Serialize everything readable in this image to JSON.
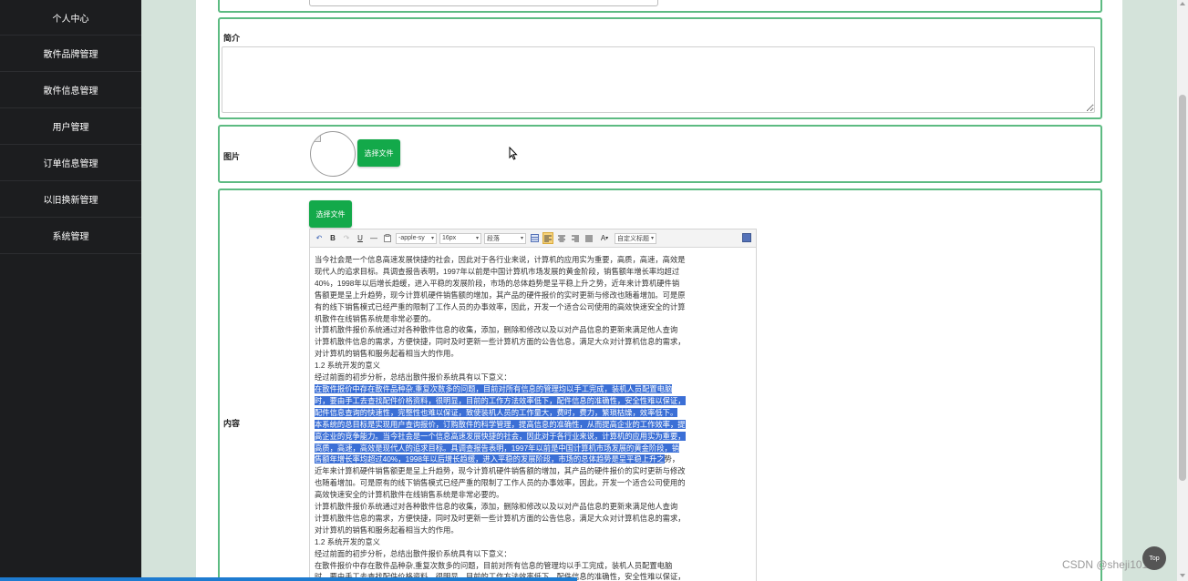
{
  "sidebar": {
    "items": [
      {
        "label": "个人中心"
      },
      {
        "label": "散件品牌管理"
      },
      {
        "label": "散件信息管理"
      },
      {
        "label": "用户管理"
      },
      {
        "label": "订单信息管理"
      },
      {
        "label": "以旧换新管理"
      },
      {
        "label": "系统管理"
      }
    ]
  },
  "form": {
    "intro_label": "简介",
    "intro_value": "",
    "image_label": "图片",
    "image_button": "选择文件",
    "content_label": "内容",
    "content_button": "选择文件"
  },
  "editor": {
    "toolbar": {
      "undo": "↶",
      "bold": "B",
      "redo": "↷",
      "underline": "U",
      "hr": "—",
      "font_family": "-apple-sy",
      "font_size": "16px",
      "paragraph": "段落",
      "font_color": "A",
      "custom_title": "自定义标题"
    },
    "lines": [
      {
        "text": "当今社会是一个信息高速发展快捷的社会，因此对于各行业来说，计算机的应用实为重要，高质，高速，高效是",
        "sel": false
      },
      {
        "text": "现代人的追求目标。具调查报告表明，1997年以前是中国计算机市场发展的黄金阶段，销售额年增长率均超过",
        "sel": false
      },
      {
        "text": "40%，1998年以后增长趋缓，进入平稳的发展阶段，市场的总体趋势是呈平稳上升之势，近年来计算机硬件销",
        "sel": false
      },
      {
        "text": "售额更是呈上升趋势，现今计算机硬件销售额的增加，其产品的硬件报价的实时更新与修改也随着增加。可是原",
        "sel": false
      },
      {
        "text": "有的线下销售模式已经严重的限制了工作人员的办事效率，因此，开发一个适合公司使用的高效快速安全的计算",
        "sel": false
      },
      {
        "text": "机散件在线销售系统是非常必要的。",
        "sel": false
      },
      {
        "text": "计算机散件报价系统通过对各种散件信息的收集，添加，删除和修改以及以对产品信息的更新来满足他人查询",
        "sel": false
      },
      {
        "text": "计算机散件信息的需求，方便快捷，同时及时更新一些计算机方面的公告信息，满足大众对计算机信息的需求，",
        "sel": false
      },
      {
        "text": "对计算机的销售和服务起着相当大的作用。",
        "sel": false
      },
      {
        "text": "1.2 系统开发的意义",
        "sel": false
      },
      {
        "text": "经过前面的初步分析，总结出散件报价系统具有以下意义：",
        "sel": false
      },
      {
        "text": "在散件报价中存在散件品种杂,重复次数多的问题，目前对所有信息的管理均以手工完成，装机人员配置电脑",
        "sel": true
      },
      {
        "text": "时，要由手工去查找配件价格资料，很明显，目前的工作方法效率低下，配件信息的准确性，安全性难以保证，",
        "sel": true
      },
      {
        "text": "配件信息查询的快速性，完整性也难以保证，致使装机人员的工作量大，费时，费力，繁琐枯燥，效率低下。",
        "sel": true
      },
      {
        "text": "本系统的总目标是实现用户查询报价，订购散件的科学管理，提高信息的准确性，从而提高企业的工作效率，提",
        "sel": true
      },
      {
        "text": "高企业的竞争能力。当今社会是一个信息高速发展快捷的社会，因此对于各行业来说，计算机的应用实为重要，",
        "sel": true
      },
      {
        "text": "高质，高速，高效是现代人的追求目标。具调查报告表明，1997年以前是中国计算机市场发展的黄金阶段，销",
        "sel": true
      },
      {
        "text": "售额年增长率均超过40%，1998年以后增长趋缓，进入平稳的发展阶段，市场的总体趋势是呈平稳上升之势，",
        "sel": "partial"
      },
      {
        "text": "近年来计算机硬件销售额更是呈上升趋势，现今计算机硬件销售额的增加，其产品的硬件报价的实时更新与修改",
        "sel": false
      },
      {
        "text": "也随着增加。可是原有的线下销售模式已经严重的限制了工作人员的办事效率，因此，开发一个适合公司使用的",
        "sel": false
      },
      {
        "text": "高效快速安全的计算机散件在线销售系统是非常必要的。",
        "sel": false
      },
      {
        "text": "计算机散件报价系统通过对各种散件信息的收集，添加，删除和修改以及以对产品信息的更新来满足他人查询",
        "sel": false
      },
      {
        "text": "计算机散件信息的需求，方便快捷，同时及时更新一些计算机方面的公告信息，满足大众对计算机信息的需求，",
        "sel": false
      },
      {
        "text": "对计算机的销售和服务起着相当大的作用。",
        "sel": false
      },
      {
        "text": "1.2 系统开发的意义",
        "sel": false
      },
      {
        "text": "经过前面的初步分析，总结出散件报价系统具有以下意义：",
        "sel": false
      },
      {
        "text": "在散件报价中存在散件品种杂,重复次数多的问题，目前对所有信息的管理均以手工完成，装机人员配置电脑",
        "sel": false
      },
      {
        "text": "时，要由手工去查找配件价格资料，很明显，目前的工作方法效率低下，配件信息的准确性，安全性难以保证，",
        "sel": false
      }
    ]
  },
  "watermark": "CSDN @sheji1011",
  "back_to_top": "Top",
  "colors": {
    "sidebar_bg": "#1c1d1f",
    "accent_green": "#13a94a",
    "row_border": "#5dbb82",
    "selection": "#3b6fd6"
  }
}
